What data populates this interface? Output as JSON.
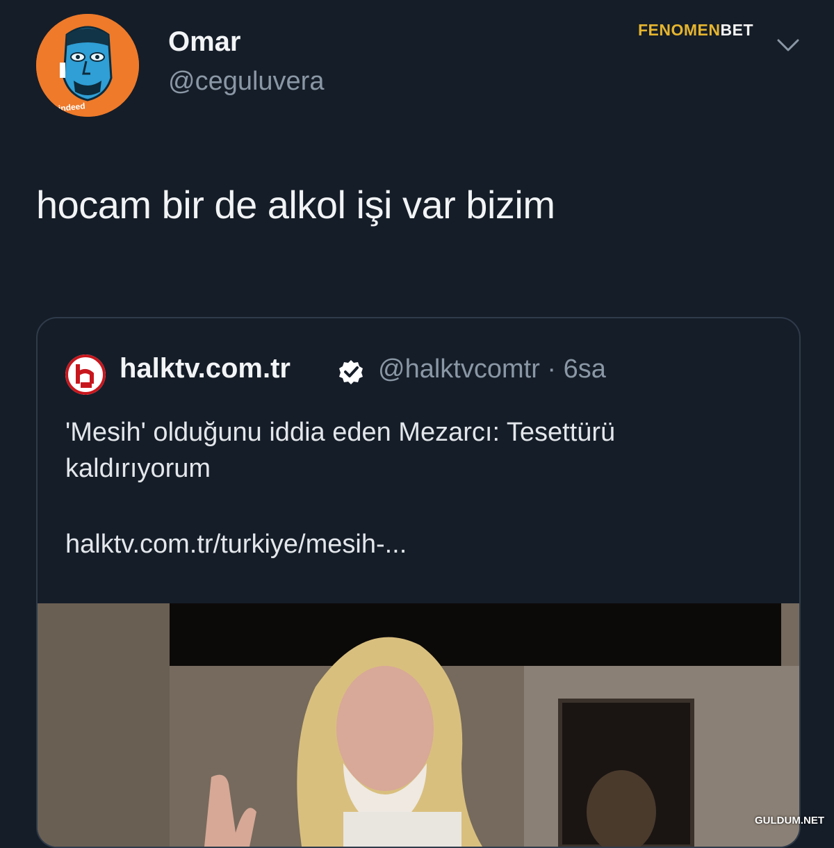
{
  "tweet": {
    "display_name": "Omar",
    "handle": "@ceguluvera",
    "text": "hocam bir de alkol işi var bizim",
    "avatar_icon": "cartoon-face-avatar",
    "avatar_caption": "h. indeed",
    "menu_icon": "chevron-down-icon"
  },
  "brand": {
    "part1": "FEN",
    "part2": "OMEN",
    "part3": "BET",
    "accent_color": "#e6b52e"
  },
  "quote": {
    "display_name": "halktv.com.tr",
    "handle_time": "@halktvcomtr · 6sa",
    "text": "'Mesih' olduğunu iddia eden Mezarcı: Tesettürü kaldırıyorum",
    "link": "halktv.com.tr/turkiye/mesih-...",
    "verified_icon": "verified-badge-icon",
    "media_description_icon": "photo"
  },
  "watermark": "GULDUM.NET",
  "colors": {
    "background": "#151d28",
    "border": "#2f3b4a",
    "secondary_text": "#8a97a5",
    "avatar_bg": "#ee7a2a"
  }
}
